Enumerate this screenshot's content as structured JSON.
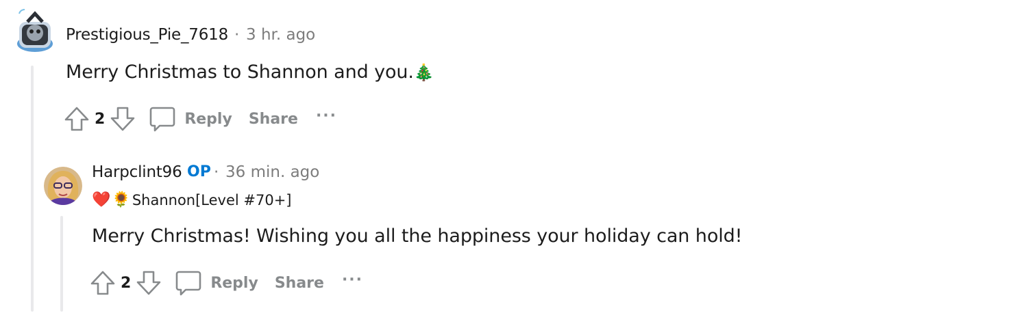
{
  "comments": [
    {
      "username": "Prestigious_Pie_7618",
      "separator": "·",
      "timestamp": "3 hr. ago",
      "body": "Merry Christmas to Shannon and you.",
      "body_emoji": "🎄",
      "votes": "2",
      "reply_label": "Reply",
      "share_label": "Share",
      "more_label": "···"
    },
    {
      "username": "Harpclint96",
      "op_badge": "OP",
      "separator": "·",
      "timestamp": "36 min. ago",
      "flair_heart": "❤️",
      "flair_flower": "🌻",
      "flair_text": "Shannon[Level #70+]",
      "body": "Merry Christmas! Wishing you all the happiness your holiday can hold!",
      "votes": "2",
      "reply_label": "Reply",
      "share_label": "Share",
      "more_label": "···"
    }
  ],
  "colors": {
    "op_badge": "#0079d3",
    "muted": "#878a8c",
    "thread_line": "#e9e9eb"
  }
}
